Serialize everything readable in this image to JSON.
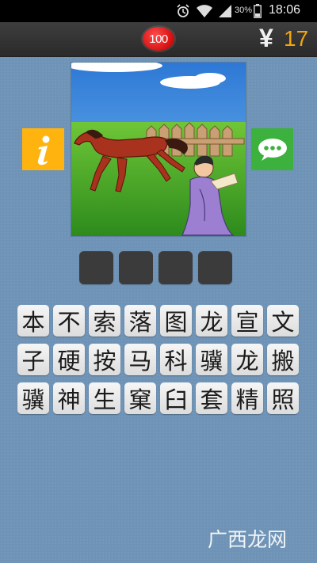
{
  "status_bar": {
    "icons": [
      "alarm-icon",
      "wifi-icon",
      "signal-icon",
      "battery-icon"
    ],
    "battery_text": "30%",
    "time": "18:06"
  },
  "header": {
    "level": "100",
    "coin_symbol": "¥",
    "coins": "17"
  },
  "puzzle": {
    "image_description_icon": "horse-and-scholar-illustration",
    "info_button_icon": "info-icon",
    "share_button_icon": "chat-icon"
  },
  "answer": {
    "slots": [
      "",
      "",
      "",
      ""
    ]
  },
  "characters": [
    [
      "本",
      "不",
      "索",
      "落",
      "图",
      "龙",
      "宣",
      "文"
    ],
    [
      "子",
      "硬",
      "按",
      "马",
      "科",
      "骥",
      "龙",
      "搬"
    ],
    [
      "骥",
      "神",
      "生",
      "窠",
      "臼",
      "套",
      "精",
      "照"
    ]
  ],
  "watermark": "广西龙网",
  "colors": {
    "background": "#6f93b6",
    "level_badge": "#e01414",
    "coins": "#f2a50e",
    "info_button": "#ffb30f",
    "chat_button": "#3db13d"
  }
}
